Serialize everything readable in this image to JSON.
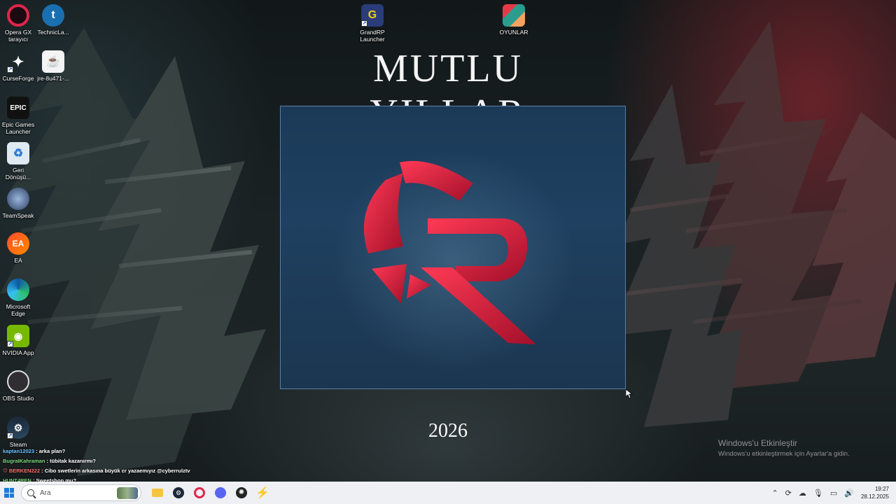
{
  "desktop": {
    "icons": [
      {
        "label": "Opera GX tarayıcı",
        "icon": "opera-gx-icon"
      },
      {
        "label": "TechnicLa...",
        "icon": "technic-launcher-icon"
      },
      {
        "label": "CurseForge",
        "icon": "curseforge-icon"
      },
      {
        "label": "jre-8u471-...",
        "icon": "java-installer-icon"
      },
      {
        "label": "Epic Games Launcher",
        "icon": "epic-games-icon"
      },
      {
        "label": "Geri Dönüşü...",
        "icon": "recycle-bin-icon"
      },
      {
        "label": "TeamSpeak",
        "icon": "teamspeak-icon"
      },
      {
        "label": "EA",
        "icon": "ea-icon"
      },
      {
        "label": "Microsoft Edge",
        "icon": "edge-icon"
      },
      {
        "label": "NVIDIA App",
        "icon": "nvidia-icon"
      },
      {
        "label": "OBS Studio",
        "icon": "obs-icon"
      },
      {
        "label": "Steam",
        "icon": "steam-icon"
      },
      {
        "label": "GrandRP Launcher",
        "icon": "grandrp-launcher-icon"
      },
      {
        "label": "OYUNLAR",
        "icon": "folder-games-icon"
      }
    ]
  },
  "wallpaper": {
    "title": "MUTLU YILLAR",
    "year": "2026",
    "logo": "grandrp-logo",
    "accent": "#d11f3b"
  },
  "chat": [
    {
      "user": "kaptan12023",
      "message": ": arka plan?"
    },
    {
      "user": "BugraIKahraman",
      "message": ": tübitak kazanırmı?"
    },
    {
      "user": "BERKEN222",
      "message": ": Cibo swetlerin arkasına büyük cr yazaemıyız @cyberrulztv"
    },
    {
      "user": "HUNT4REN",
      "message": ": Sweetshop mu?"
    }
  ],
  "activation": {
    "heading": "Windows'u Etkinleştir",
    "sub": "Windows'u etkinleştirmek için Ayarlar'a gidin."
  },
  "taskbar": {
    "search_placeholder": "Ara",
    "pinned": [
      "file-explorer-icon",
      "steam-icon",
      "opera-gx-icon",
      "discord-icon",
      "chatgpt-icon",
      "bolt-app-icon"
    ],
    "time": "19:27",
    "date": "28.12.2025"
  }
}
